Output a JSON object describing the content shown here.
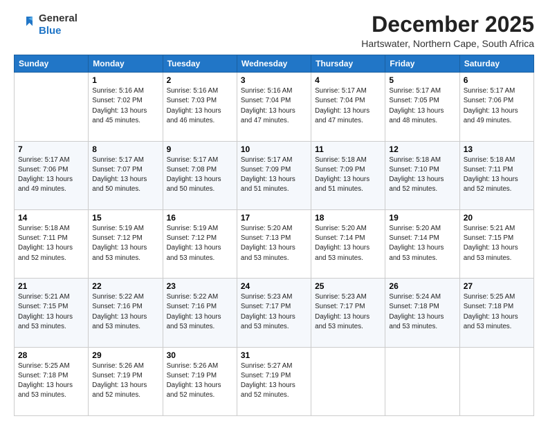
{
  "logo": {
    "general": "General",
    "blue": "Blue"
  },
  "title": {
    "month": "December 2025",
    "location": "Hartswater, Northern Cape, South Africa"
  },
  "weekdays": [
    "Sunday",
    "Monday",
    "Tuesday",
    "Wednesday",
    "Thursday",
    "Friday",
    "Saturday"
  ],
  "weeks": [
    [
      {
        "date": "",
        "info": ""
      },
      {
        "date": "1",
        "info": "Sunrise: 5:16 AM\nSunset: 7:02 PM\nDaylight: 13 hours\nand 45 minutes."
      },
      {
        "date": "2",
        "info": "Sunrise: 5:16 AM\nSunset: 7:03 PM\nDaylight: 13 hours\nand 46 minutes."
      },
      {
        "date": "3",
        "info": "Sunrise: 5:16 AM\nSunset: 7:04 PM\nDaylight: 13 hours\nand 47 minutes."
      },
      {
        "date": "4",
        "info": "Sunrise: 5:17 AM\nSunset: 7:04 PM\nDaylight: 13 hours\nand 47 minutes."
      },
      {
        "date": "5",
        "info": "Sunrise: 5:17 AM\nSunset: 7:05 PM\nDaylight: 13 hours\nand 48 minutes."
      },
      {
        "date": "6",
        "info": "Sunrise: 5:17 AM\nSunset: 7:06 PM\nDaylight: 13 hours\nand 49 minutes."
      }
    ],
    [
      {
        "date": "7",
        "info": "Sunrise: 5:17 AM\nSunset: 7:06 PM\nDaylight: 13 hours\nand 49 minutes."
      },
      {
        "date": "8",
        "info": "Sunrise: 5:17 AM\nSunset: 7:07 PM\nDaylight: 13 hours\nand 50 minutes."
      },
      {
        "date": "9",
        "info": "Sunrise: 5:17 AM\nSunset: 7:08 PM\nDaylight: 13 hours\nand 50 minutes."
      },
      {
        "date": "10",
        "info": "Sunrise: 5:17 AM\nSunset: 7:09 PM\nDaylight: 13 hours\nand 51 minutes."
      },
      {
        "date": "11",
        "info": "Sunrise: 5:18 AM\nSunset: 7:09 PM\nDaylight: 13 hours\nand 51 minutes."
      },
      {
        "date": "12",
        "info": "Sunrise: 5:18 AM\nSunset: 7:10 PM\nDaylight: 13 hours\nand 52 minutes."
      },
      {
        "date": "13",
        "info": "Sunrise: 5:18 AM\nSunset: 7:11 PM\nDaylight: 13 hours\nand 52 minutes."
      }
    ],
    [
      {
        "date": "14",
        "info": "Sunrise: 5:18 AM\nSunset: 7:11 PM\nDaylight: 13 hours\nand 52 minutes."
      },
      {
        "date": "15",
        "info": "Sunrise: 5:19 AM\nSunset: 7:12 PM\nDaylight: 13 hours\nand 53 minutes."
      },
      {
        "date": "16",
        "info": "Sunrise: 5:19 AM\nSunset: 7:12 PM\nDaylight: 13 hours\nand 53 minutes."
      },
      {
        "date": "17",
        "info": "Sunrise: 5:20 AM\nSunset: 7:13 PM\nDaylight: 13 hours\nand 53 minutes."
      },
      {
        "date": "18",
        "info": "Sunrise: 5:20 AM\nSunset: 7:14 PM\nDaylight: 13 hours\nand 53 minutes."
      },
      {
        "date": "19",
        "info": "Sunrise: 5:20 AM\nSunset: 7:14 PM\nDaylight: 13 hours\nand 53 minutes."
      },
      {
        "date": "20",
        "info": "Sunrise: 5:21 AM\nSunset: 7:15 PM\nDaylight: 13 hours\nand 53 minutes."
      }
    ],
    [
      {
        "date": "21",
        "info": "Sunrise: 5:21 AM\nSunset: 7:15 PM\nDaylight: 13 hours\nand 53 minutes."
      },
      {
        "date": "22",
        "info": "Sunrise: 5:22 AM\nSunset: 7:16 PM\nDaylight: 13 hours\nand 53 minutes."
      },
      {
        "date": "23",
        "info": "Sunrise: 5:22 AM\nSunset: 7:16 PM\nDaylight: 13 hours\nand 53 minutes."
      },
      {
        "date": "24",
        "info": "Sunrise: 5:23 AM\nSunset: 7:17 PM\nDaylight: 13 hours\nand 53 minutes."
      },
      {
        "date": "25",
        "info": "Sunrise: 5:23 AM\nSunset: 7:17 PM\nDaylight: 13 hours\nand 53 minutes."
      },
      {
        "date": "26",
        "info": "Sunrise: 5:24 AM\nSunset: 7:18 PM\nDaylight: 13 hours\nand 53 minutes."
      },
      {
        "date": "27",
        "info": "Sunrise: 5:25 AM\nSunset: 7:18 PM\nDaylight: 13 hours\nand 53 minutes."
      }
    ],
    [
      {
        "date": "28",
        "info": "Sunrise: 5:25 AM\nSunset: 7:18 PM\nDaylight: 13 hours\nand 53 minutes."
      },
      {
        "date": "29",
        "info": "Sunrise: 5:26 AM\nSunset: 7:19 PM\nDaylight: 13 hours\nand 52 minutes."
      },
      {
        "date": "30",
        "info": "Sunrise: 5:26 AM\nSunset: 7:19 PM\nDaylight: 13 hours\nand 52 minutes."
      },
      {
        "date": "31",
        "info": "Sunrise: 5:27 AM\nSunset: 7:19 PM\nDaylight: 13 hours\nand 52 minutes."
      },
      {
        "date": "",
        "info": ""
      },
      {
        "date": "",
        "info": ""
      },
      {
        "date": "",
        "info": ""
      }
    ]
  ]
}
